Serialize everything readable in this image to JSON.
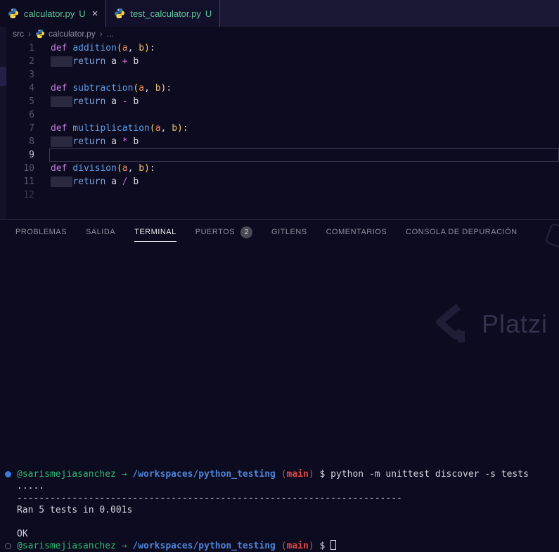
{
  "tabs": [
    {
      "label": "calculator.py",
      "git_badge": "U",
      "active": true,
      "close_glyph": "×"
    },
    {
      "label": "test_calculator.py",
      "git_badge": "U",
      "active": false
    }
  ],
  "breadcrumb": {
    "items": [
      {
        "label": "src",
        "icon": null
      },
      {
        "label": "calculator.py",
        "icon": "python-icon"
      },
      {
        "label": "...",
        "icon": null
      }
    ],
    "separator": "›"
  },
  "editor": {
    "lines": [
      {
        "num": "1",
        "tokens": [
          {
            "t": "def",
            "c": "kw"
          },
          {
            "t": " ",
            "c": "pl"
          },
          {
            "t": "addition",
            "c": "fn"
          },
          {
            "t": "(",
            "c": "br"
          },
          {
            "t": "a",
            "c": "pa"
          },
          {
            "t": ", ",
            "c": "pu"
          },
          {
            "t": "b",
            "c": "pb"
          },
          {
            "t": ")",
            "c": "br"
          },
          {
            "t": ":",
            "c": "pu"
          }
        ]
      },
      {
        "num": "2",
        "tokens": [
          {
            "t": "    ",
            "c": "ind"
          },
          {
            "t": "return",
            "c": "ret"
          },
          {
            "t": " ",
            "c": "pl"
          },
          {
            "t": "a",
            "c": "va"
          },
          {
            "t": " ",
            "c": "pl"
          },
          {
            "t": "+",
            "c": "op"
          },
          {
            "t": " ",
            "c": "pl"
          },
          {
            "t": "b",
            "c": "va"
          }
        ]
      },
      {
        "num": "3",
        "tokens": []
      },
      {
        "num": "4",
        "tokens": [
          {
            "t": "def",
            "c": "kw"
          },
          {
            "t": " ",
            "c": "pl"
          },
          {
            "t": "subtraction",
            "c": "fn"
          },
          {
            "t": "(",
            "c": "br"
          },
          {
            "t": "a",
            "c": "pa"
          },
          {
            "t": ", ",
            "c": "pu"
          },
          {
            "t": "b",
            "c": "pb"
          },
          {
            "t": ")",
            "c": "br"
          },
          {
            "t": ":",
            "c": "pu"
          }
        ]
      },
      {
        "num": "5",
        "tokens": [
          {
            "t": "    ",
            "c": "ind"
          },
          {
            "t": "return",
            "c": "ret"
          },
          {
            "t": " ",
            "c": "pl"
          },
          {
            "t": "a",
            "c": "va"
          },
          {
            "t": " ",
            "c": "pl"
          },
          {
            "t": "-",
            "c": "op"
          },
          {
            "t": " ",
            "c": "pl"
          },
          {
            "t": "b",
            "c": "va"
          }
        ]
      },
      {
        "num": "6",
        "tokens": []
      },
      {
        "num": "7",
        "tokens": [
          {
            "t": "def",
            "c": "kw"
          },
          {
            "t": " ",
            "c": "pl"
          },
          {
            "t": "multiplication",
            "c": "fn"
          },
          {
            "t": "(",
            "c": "br"
          },
          {
            "t": "a",
            "c": "pa"
          },
          {
            "t": ", ",
            "c": "pu"
          },
          {
            "t": "b",
            "c": "pb"
          },
          {
            "t": ")",
            "c": "br"
          },
          {
            "t": ":",
            "c": "pu"
          }
        ]
      },
      {
        "num": "8",
        "tokens": [
          {
            "t": "    ",
            "c": "ind"
          },
          {
            "t": "return",
            "c": "ret"
          },
          {
            "t": " ",
            "c": "pl"
          },
          {
            "t": "a",
            "c": "va"
          },
          {
            "t": " ",
            "c": "pl"
          },
          {
            "t": "*",
            "c": "op"
          },
          {
            "t": " ",
            "c": "pl"
          },
          {
            "t": "b",
            "c": "va"
          }
        ]
      },
      {
        "num": "9",
        "tokens": [],
        "current": true
      },
      {
        "num": "10",
        "tokens": [
          {
            "t": "def",
            "c": "kw"
          },
          {
            "t": " ",
            "c": "pl"
          },
          {
            "t": "division",
            "c": "fn"
          },
          {
            "t": "(",
            "c": "br"
          },
          {
            "t": "a",
            "c": "pa"
          },
          {
            "t": ", ",
            "c": "pu"
          },
          {
            "t": "b",
            "c": "pb"
          },
          {
            "t": ")",
            "c": "br"
          },
          {
            "t": ":",
            "c": "pu"
          }
        ]
      },
      {
        "num": "11",
        "tokens": [
          {
            "t": "    ",
            "c": "ind"
          },
          {
            "t": "return",
            "c": "ret"
          },
          {
            "t": " ",
            "c": "pl"
          },
          {
            "t": "a",
            "c": "va"
          },
          {
            "t": " ",
            "c": "pl"
          },
          {
            "t": "/",
            "c": "op"
          },
          {
            "t": " ",
            "c": "pl"
          },
          {
            "t": "b",
            "c": "va"
          }
        ]
      },
      {
        "num": "12",
        "tokens": [],
        "dim": true
      }
    ]
  },
  "panel_tabs": [
    {
      "label": "PROBLEMAS"
    },
    {
      "label": "SALIDA"
    },
    {
      "label": "TERMINAL",
      "active": true
    },
    {
      "label": "PUERTOS",
      "badge": "2"
    },
    {
      "label": "GITLENS"
    },
    {
      "label": "COMENTARIOS"
    },
    {
      "label": "CONSOLA DE DEPURACIÓN"
    }
  ],
  "terminal": {
    "lines": [
      {
        "deco": "filled",
        "tokens": [
          {
            "t": "@sarismejiasanchez",
            "c": "user"
          },
          {
            "t": " ",
            "c": "pl"
          },
          {
            "t": "→",
            "c": "arrow"
          },
          {
            "t": " ",
            "c": "pl"
          },
          {
            "t": "/workspaces/python_testing",
            "c": "path"
          },
          {
            "t": " ",
            "c": "pl"
          },
          {
            "t": "(",
            "c": "pr"
          },
          {
            "t": "main",
            "c": "branch"
          },
          {
            "t": ")",
            "c": "pr"
          },
          {
            "t": " $ ",
            "c": "pl"
          },
          {
            "t": "python -m unittest discover -s tests",
            "c": "pl"
          }
        ]
      },
      {
        "tokens": [
          {
            "t": ".....",
            "c": "pl"
          }
        ]
      },
      {
        "tokens": [
          {
            "t": "----------------------------------------------------------------------",
            "c": "pl"
          }
        ]
      },
      {
        "tokens": [
          {
            "t": "Ran 5 tests in 0.001s",
            "c": "pl"
          }
        ]
      },
      {
        "tokens": []
      },
      {
        "tokens": [
          {
            "t": "OK",
            "c": "pl"
          }
        ]
      },
      {
        "deco": "ring",
        "cursor": true,
        "tokens": [
          {
            "t": "@sarismejiasanchez",
            "c": "user"
          },
          {
            "t": " ",
            "c": "pl"
          },
          {
            "t": "→",
            "c": "arrow"
          },
          {
            "t": " ",
            "c": "pl"
          },
          {
            "t": "/workspaces/python_testing",
            "c": "path"
          },
          {
            "t": " ",
            "c": "pl"
          },
          {
            "t": "(",
            "c": "pr"
          },
          {
            "t": "main",
            "c": "branch"
          },
          {
            "t": ")",
            "c": "pr"
          },
          {
            "t": " $ ",
            "c": "pl"
          }
        ]
      }
    ]
  },
  "watermark": {
    "text": "Platzi"
  },
  "colors": {
    "background": "#0d0b1f",
    "tabbar_background": "#1b1836",
    "untracked_green": "#60c49a",
    "keyword_purple": "#c17fd8",
    "return_blue": "#7fa3da",
    "function_blue": "#5f9fe8",
    "bracket_yellow": "#ffd14f",
    "param_a_orange": "#ef8a5f",
    "param_b_yellow": "#e6c472",
    "operator_pink": "#d368d8",
    "prompt_user_green": "#2fb873",
    "prompt_path_blue": "#4d84d8",
    "prompt_branch_red": "#e04545",
    "command_decoration_blue": "#3a7bd8",
    "python_icon_blue": "#3776ab",
    "python_icon_yellow": "#ffd43b"
  }
}
